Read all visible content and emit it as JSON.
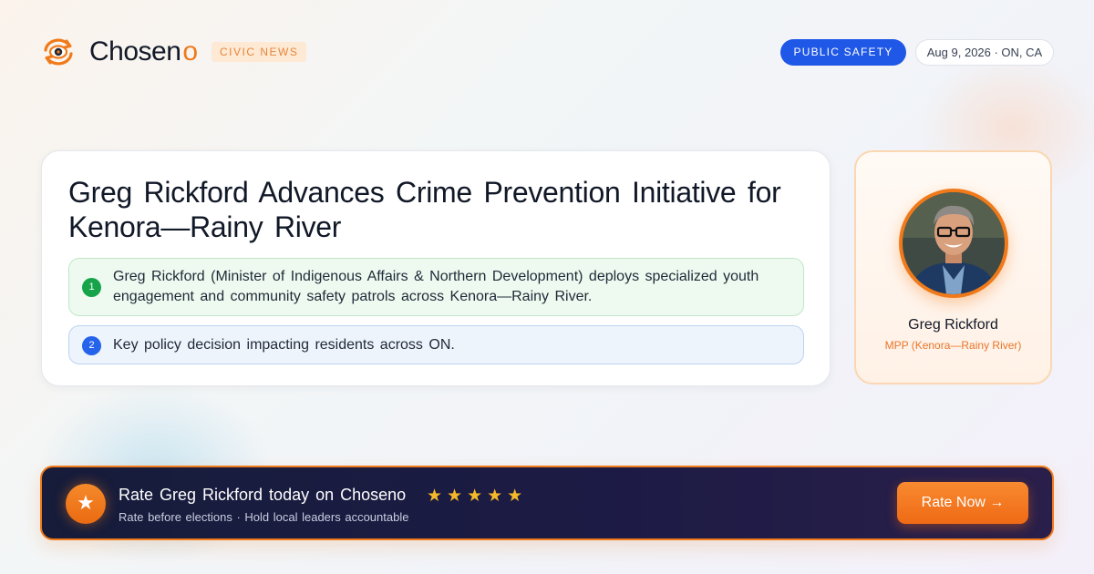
{
  "header": {
    "brand_name": "Chosen",
    "brand_suffix": "o",
    "section_badge": "CIVIC NEWS",
    "category_pill": "PUBLIC SAFETY",
    "date_location": "Aug 9, 2026 · ON, CA"
  },
  "article": {
    "title": "Greg Rickford Advances Crime Prevention Initiative for Kenora—Rainy River",
    "points": [
      {
        "number": "1",
        "text": "Greg Rickford (Minister of Indigenous Affairs & Northern Development) deploys specialized youth engagement and community safety patrols across Kenora—Rainy River."
      },
      {
        "number": "2",
        "text": "Key policy decision impacting residents across ON."
      }
    ]
  },
  "profile": {
    "name": "Greg Rickford",
    "role": "MPP (Kenora—Rainy River)"
  },
  "banner": {
    "title": "Rate Greg Rickford today on Choseno",
    "stars": "★★★★★",
    "subtitle": "Rate before elections · Hold local leaders accountable",
    "button_label": "Rate Now →"
  },
  "colors": {
    "accent_orange": "#f07a1a",
    "primary_blue": "#1f57e6",
    "success_green": "#16a34a",
    "banner_dark": "#1a1c40",
    "star_gold": "#f5b82a"
  },
  "icons": {
    "logo": "eye-cycle-logo-icon",
    "banner_badge": "star-icon",
    "button": "arrow-right-icon"
  }
}
